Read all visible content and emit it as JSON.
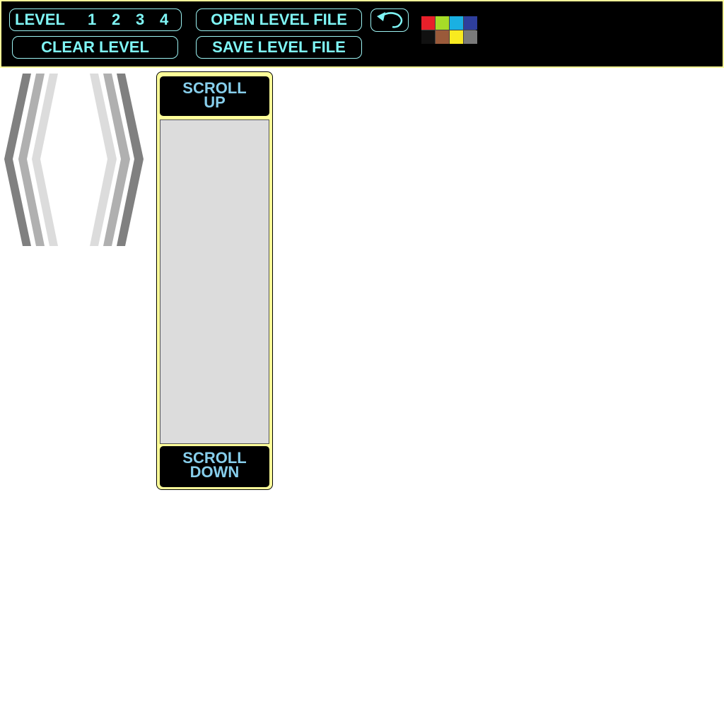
{
  "toolbar": {
    "level_label": "LEVEL",
    "levels": [
      "1",
      "2",
      "3",
      "4"
    ],
    "clear_label": "CLEAR LEVEL",
    "open_label": "OPEN LEVEL FILE",
    "save_label": "SAVE LEVEL FILE",
    "undo_icon": "undo-arrow-icon"
  },
  "palette": {
    "colors": [
      "#e8202a",
      "#a6dc28",
      "#1ab0e2",
      "#2e3e9c",
      "#111111",
      "#9a5a3a",
      "#f8ea20",
      "#7a7a7a"
    ]
  },
  "chevrons": {
    "icon": "chevron-pair-icon",
    "shades": [
      "#808080",
      "#b0b0b0",
      "#dcdcdc"
    ]
  },
  "scroll": {
    "up_line1": "SCROLL",
    "up_line2": "UP",
    "down_line1": "SCROLL",
    "down_line2": "DOWN"
  },
  "theme": {
    "toolbar_bg": "#000000",
    "toolbar_border": "#ffff99",
    "button_text": "#7ff5f5",
    "scroll_text": "#87ceeb",
    "panel_bg": "#ffff99",
    "list_bg": "#dcdcdc"
  }
}
